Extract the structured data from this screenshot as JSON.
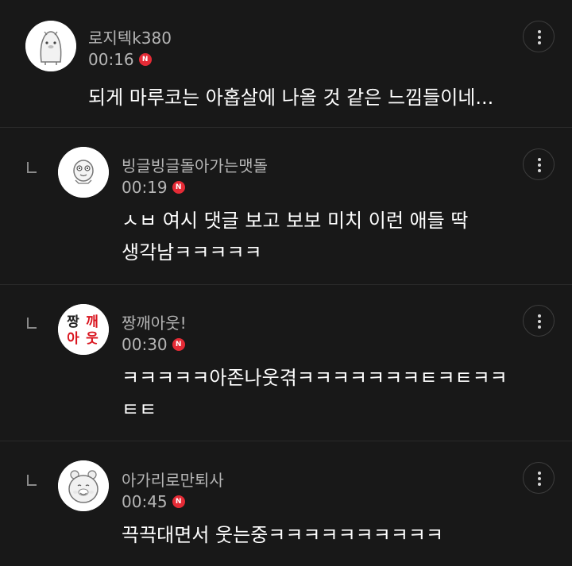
{
  "comments": [
    {
      "username": "로지텍k380",
      "time": "00:16",
      "badge": "N",
      "lines": [
        "되게 마루코는 아홉살에 나올 것 같은 느낌들이네..."
      ],
      "avatar_icon": "penguin-character-icon"
    },
    {
      "username": "빙글빙글돌아가는맷돌",
      "time": "00:19",
      "badge": "N",
      "lines": [
        "ㅅㅂ 여시 댓글 보고 보보 미치 이런 애들 딱",
        "생각남ㅋㅋㅋㅋㅋ"
      ],
      "avatar_icon": "cartoon-face-icon"
    },
    {
      "username": "짱깨아웃!",
      "time": "00:30",
      "badge": "N",
      "lines": [
        "ㅋㅋㅋㅋㅋ아존나웃겪ㅋㅋㅋㅋㅋㅋㅋㅌㅋㅌㅋㅋ",
        "ㅌㅌ"
      ],
      "avatar_text": [
        "짱",
        "깨",
        "아",
        "웃"
      ],
      "avatar_icon": "text-logo-icon"
    },
    {
      "username": "아가리로만퇴사",
      "time": "00:45",
      "badge": "N",
      "lines": [
        "끅끅대면서 웃는중ㅋㅋㅋㅋㅋㅋㅋㅋㅋㅋ"
      ],
      "avatar_icon": "hamster-character-icon"
    }
  ],
  "colors": {
    "background": "#181818",
    "username": "#b5b5b5",
    "badge": "#e52b36",
    "text": "#ffffff",
    "avatar_text_red": "#d9141e",
    "avatar_text_dark": "#222222"
  }
}
